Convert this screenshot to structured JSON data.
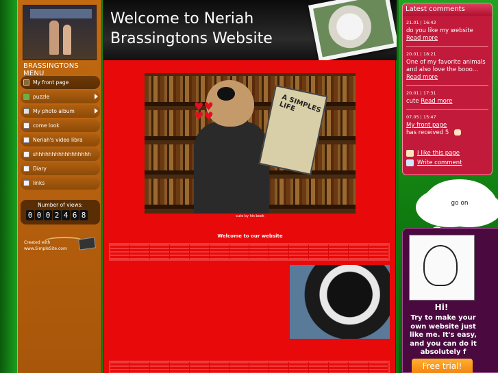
{
  "left": {
    "menu_title": "BRASSINGTONS MENU",
    "menu_items": [
      {
        "label": "My front page",
        "icon": "house-icon",
        "has_submenu": false,
        "active": true
      },
      {
        "label": "puzzle",
        "icon": "puzzle-icon",
        "has_submenu": true,
        "active": false
      },
      {
        "label": "My photo album",
        "icon": "photo-album-icon",
        "has_submenu": true,
        "active": false
      },
      {
        "label": "come look",
        "icon": "page-icon",
        "has_submenu": false,
        "active": false
      },
      {
        "label": "Neriah's video libra",
        "icon": "page-icon",
        "has_submenu": false,
        "active": false
      },
      {
        "label": "shhhhhhhhhhhhhhhhh",
        "icon": "page-icon",
        "has_submenu": false,
        "active": false
      },
      {
        "label": "Diary",
        "icon": "page-icon",
        "has_submenu": false,
        "active": false
      },
      {
        "label": "links",
        "icon": "page-icon",
        "has_submenu": false,
        "active": false
      }
    ],
    "views_label": "Number of views:",
    "views_digits": [
      "0",
      "0",
      "0",
      "2",
      "4",
      "6",
      "8"
    ],
    "created_line1": "Created with",
    "created_line2": "www.SimpleSite.com"
  },
  "header": {
    "title_line1": "Welcome to Neriah",
    "title_line2": "Brassingtons Website"
  },
  "main": {
    "image_book_text": "A SIMPLES LIFE",
    "image_caption": "cute by his book",
    "welcome_text": "Welcome to our website"
  },
  "comments": {
    "title": "Latest comments",
    "items": [
      {
        "date": "21.01 | 16:42",
        "text": "do you like my website",
        "link": "Read more"
      },
      {
        "date": "20.01 | 18:21",
        "text": "One of my favorite animals and also love the booo...",
        "link": "Read more"
      },
      {
        "date": "20.01 | 17:31",
        "text": "cute",
        "link": "Read more"
      },
      {
        "date": "07.05 | 15:47",
        "link_text": "My front page",
        "text": "has received 5"
      }
    ],
    "like_label": "I like this page",
    "write_label": "Write comment"
  },
  "promo": {
    "cloud_text": "go on",
    "hi": "Hi!",
    "text": "Try to make your own website just like me. It's easy, and you can do it absolutely f",
    "button": "Free trial!"
  },
  "colors": {
    "main_bg": "#e80a0a",
    "menu_bg": "#c26a12",
    "comments_bg": "#c21a3a",
    "promo_bg": "#4a0a40",
    "page_bg": "#1a8a1a"
  }
}
